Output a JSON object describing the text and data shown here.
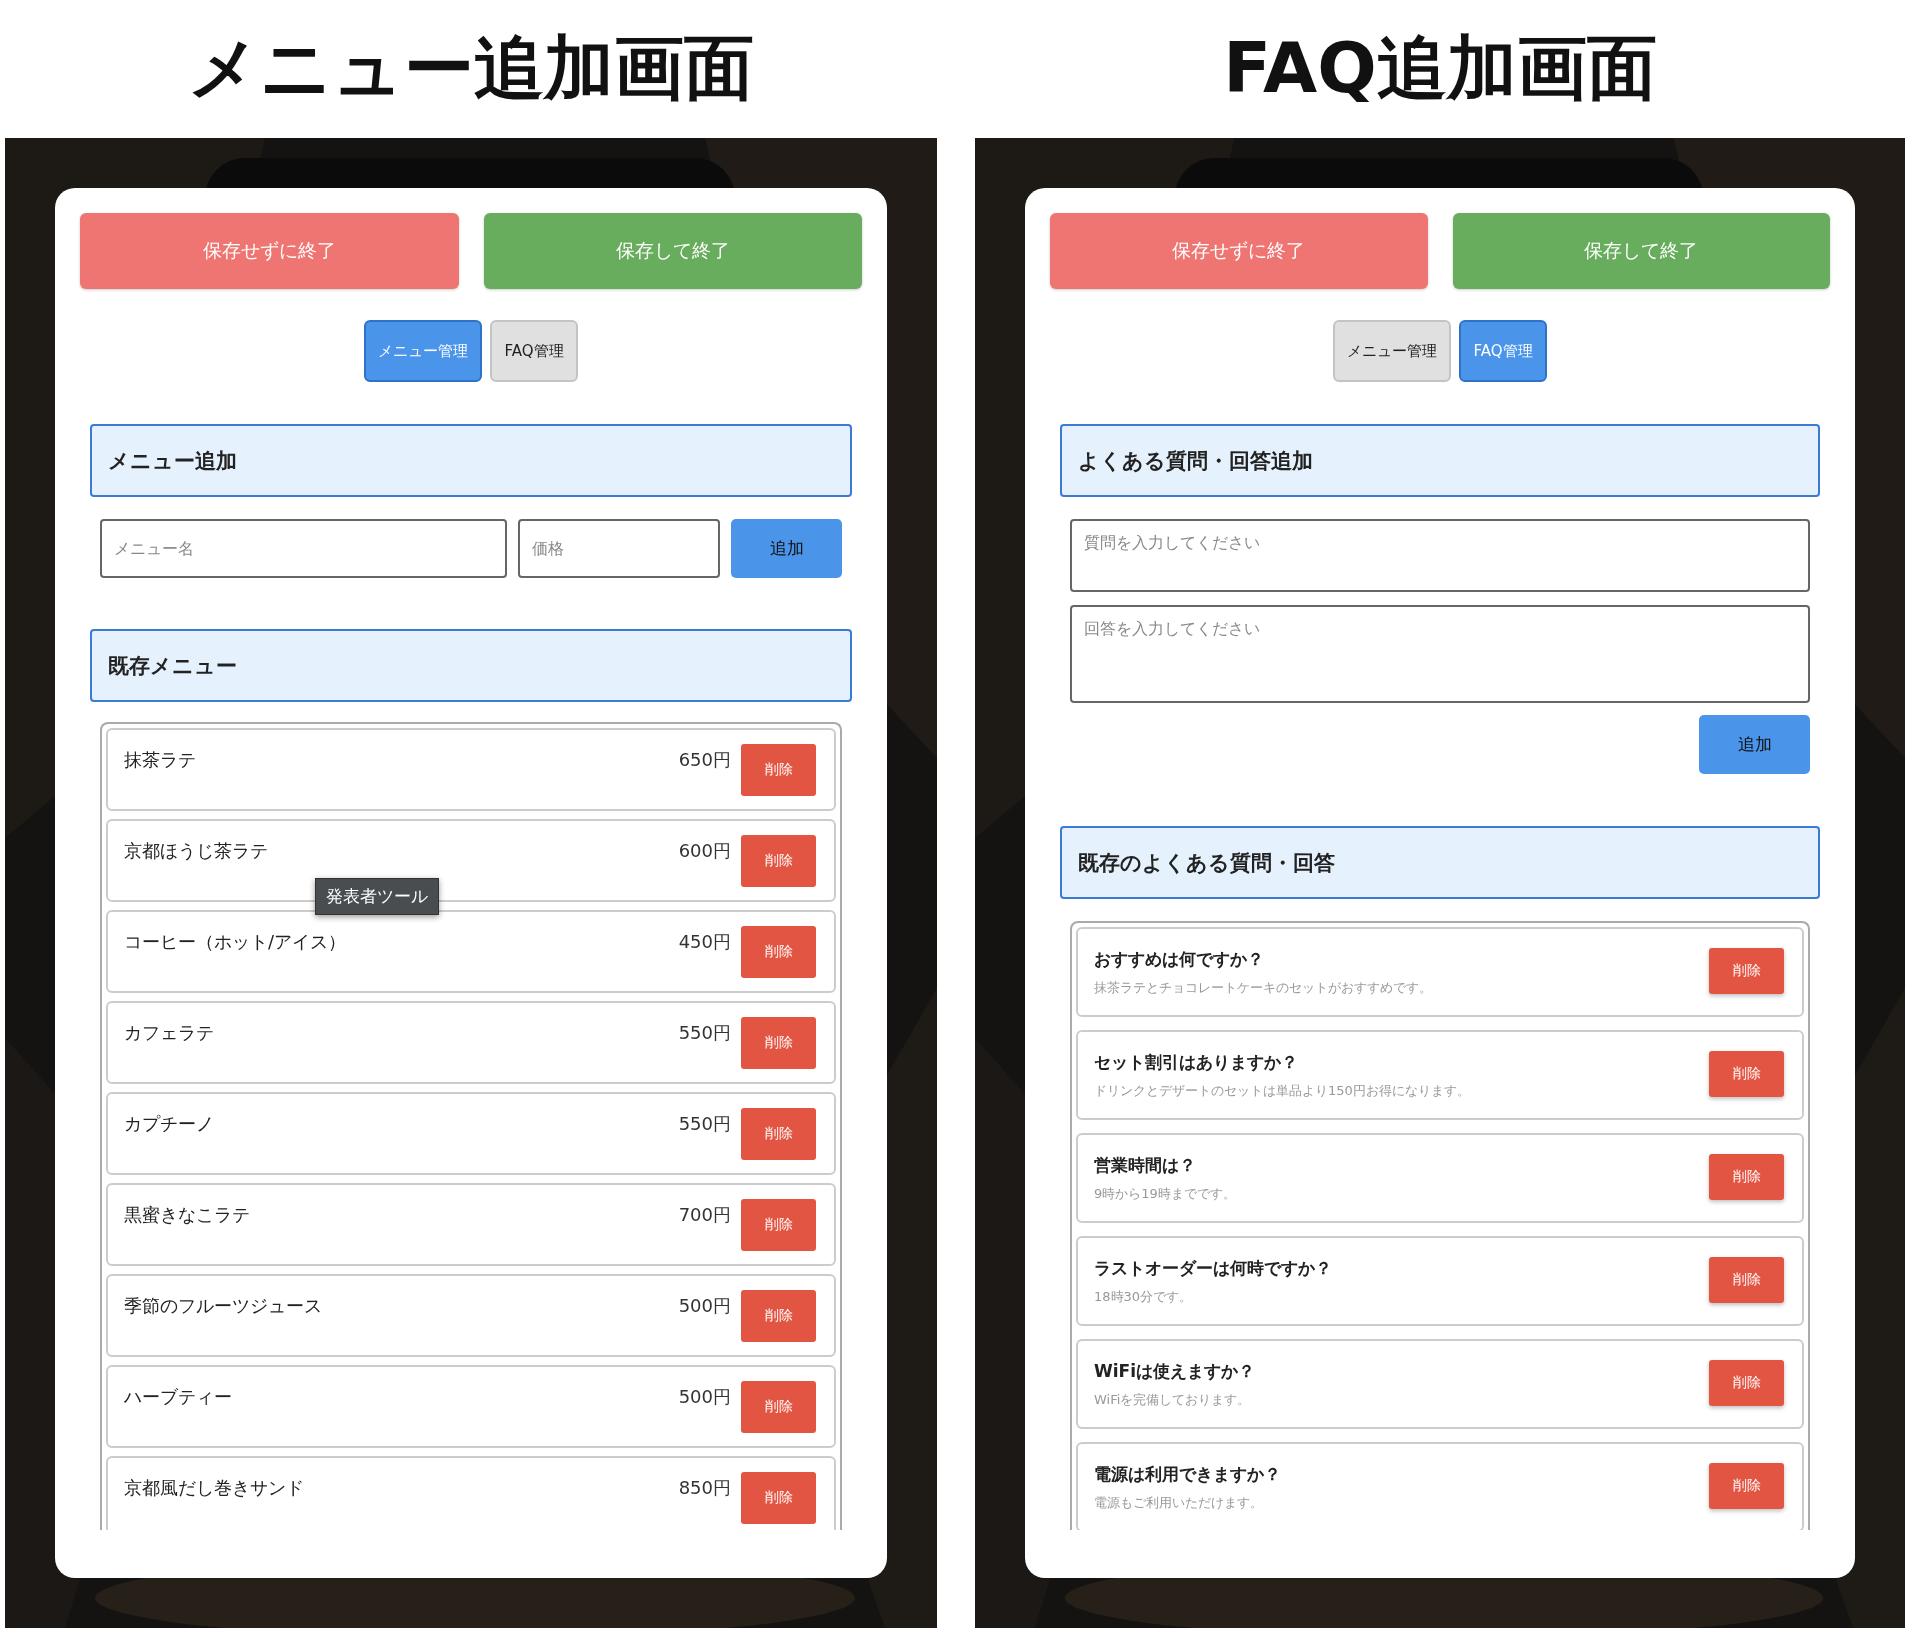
{
  "screens": [
    {
      "kind": "menu",
      "heading": "メニュー追加画面",
      "buttons": [
        {
          "kind": "discard",
          "label": "保存せずに終了"
        },
        {
          "kind": "save",
          "label": "保存して終了"
        }
      ],
      "tabs": [
        {
          "label": "メニュー管理",
          "selected": true
        },
        {
          "label": "FAQ管理",
          "selected": false
        }
      ],
      "add_section": {
        "title": "メニュー追加",
        "fields": [
          {
            "placeholder": "メニュー名"
          },
          {
            "placeholder": "価格"
          }
        ],
        "add_button": "追加"
      },
      "list_section": {
        "title": "既存メニュー",
        "items": [
          {
            "name": "抹茶ラテ",
            "price": "650円",
            "delete": "削除"
          },
          {
            "name": "京都ほうじ茶ラテ",
            "price": "600円",
            "delete": "削除"
          },
          {
            "name": "コーヒー（ホット/アイス）",
            "price": "450円",
            "delete": "削除"
          },
          {
            "name": "カフェラテ",
            "price": "550円",
            "delete": "削除"
          },
          {
            "name": "カプチーノ",
            "price": "550円",
            "delete": "削除"
          },
          {
            "name": "黒蜜きなこラテ",
            "price": "700円",
            "delete": "削除"
          },
          {
            "name": "季節のフルーツジュース",
            "price": "500円",
            "delete": "削除"
          },
          {
            "name": "ハーブティー",
            "price": "500円",
            "delete": "削除"
          },
          {
            "name": "京都風だし巻きサンド",
            "price": "850円",
            "delete": "削除"
          }
        ]
      },
      "tooltip": "発表者ツール"
    },
    {
      "kind": "faq",
      "heading": "FAQ追加画面",
      "buttons": [
        {
          "kind": "discard",
          "label": "保存せずに終了"
        },
        {
          "kind": "save",
          "label": "保存して終了"
        }
      ],
      "tabs": [
        {
          "label": "メニュー管理",
          "selected": false
        },
        {
          "label": "FAQ管理",
          "selected": true
        }
      ],
      "add_section": {
        "title": "よくある質問・回答追加",
        "fields": [
          {
            "placeholder": "質問を入力してください"
          },
          {
            "placeholder": "回答を入力してください"
          }
        ],
        "add_button": "追加"
      },
      "list_section": {
        "title": "既存のよくある質問・回答",
        "items": [
          {
            "question": "おすすめは何ですか？",
            "answer": "抹茶ラテとチョコレートケーキのセットがおすすめです。",
            "delete": "削除"
          },
          {
            "question": "セット割引はありますか？",
            "answer": "ドリンクとデザートのセットは単品より150円お得になります。",
            "delete": "削除"
          },
          {
            "question": "営業時間は？",
            "answer": "9時から19時までです。",
            "delete": "削除"
          },
          {
            "question": "ラストオーダーは何時ですか？",
            "answer": "18時30分です。",
            "delete": "削除"
          },
          {
            "question": "WiFiは使えますか？",
            "answer": "WiFiを完備しております。",
            "delete": "削除"
          },
          {
            "question": "電源は利用できますか？",
            "answer": "電源もご利用いただけます。",
            "delete": "削除"
          }
        ]
      }
    }
  ]
}
